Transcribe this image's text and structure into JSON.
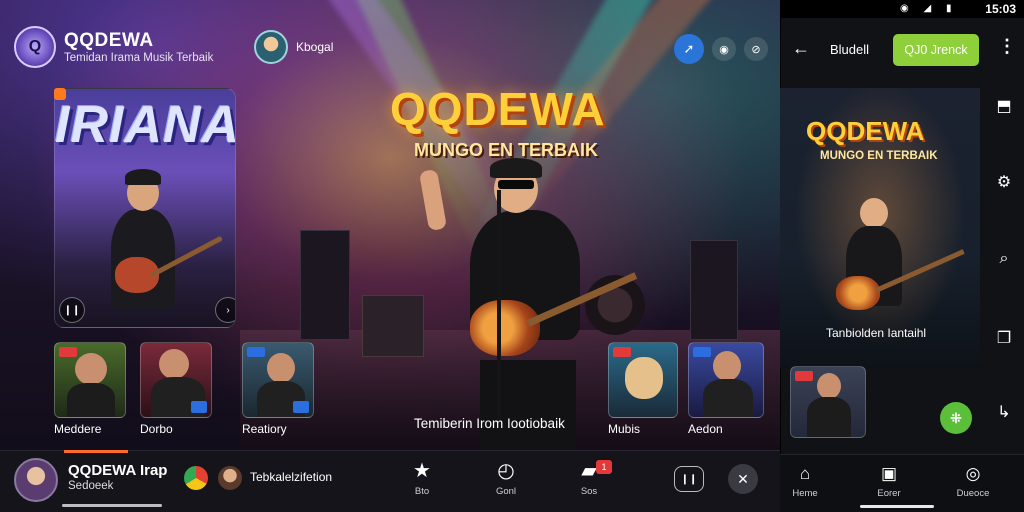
{
  "app": {
    "title": "QQDEWA",
    "subtitle": "Temidan Irama Musik Terbaik",
    "logo_text": "Q"
  },
  "user": {
    "name": "Kbogal"
  },
  "top_actions": [
    "share-icon",
    "info-icon",
    "copy-icon"
  ],
  "feature_card": {
    "word": "IRIANA"
  },
  "hero": {
    "title": "QQDEWA",
    "tagline": "MUNGO EN TERBAIK",
    "caption": "Temiberin Irom Iootiobaik"
  },
  "thumbnails": [
    {
      "label": "Meddere"
    },
    {
      "label": "Dorbo"
    },
    {
      "label": "Reatiory"
    },
    {
      "label": "Mubis"
    },
    {
      "label": "Aedon"
    }
  ],
  "bottom_bar": {
    "now_playing_title": "QQDEWA Irap",
    "now_playing_subtitle": "Sedoeek",
    "progress": 1.0,
    "chip_label": "Tebkalelzifetion",
    "nav": [
      {
        "label": "Bto",
        "icon": "star-icon"
      },
      {
        "label": "Gonl",
        "icon": "timer-icon"
      },
      {
        "label": "Sos",
        "icon": "chat-icon"
      }
    ],
    "notification_count": "1"
  },
  "phone": {
    "status_time": "15:03",
    "appbar_title": "Bludell",
    "action_button": "QJ0 Jrenck",
    "hero_title": "QQDEWA",
    "hero_tagline": "MUNGO EN TERBAIK",
    "caption": "Tanbiolden Iantaihl",
    "side_rail": [
      "bookmark-icon",
      "gear-icon",
      "search-icon",
      "copy-icon",
      "share-icon"
    ],
    "nav": [
      {
        "label": "Heme",
        "icon": "home-icon"
      },
      {
        "label": "Eorer",
        "icon": "library-icon"
      },
      {
        "label": "Dueoce",
        "icon": "profile-icon"
      }
    ]
  },
  "colors": {
    "accent_orange": "#ff6a2a",
    "title_gold": "#ffcf3a",
    "green_button": "#8fcf3a",
    "fab_green": "#5cbf3a",
    "share_blue": "#2b74d8"
  }
}
